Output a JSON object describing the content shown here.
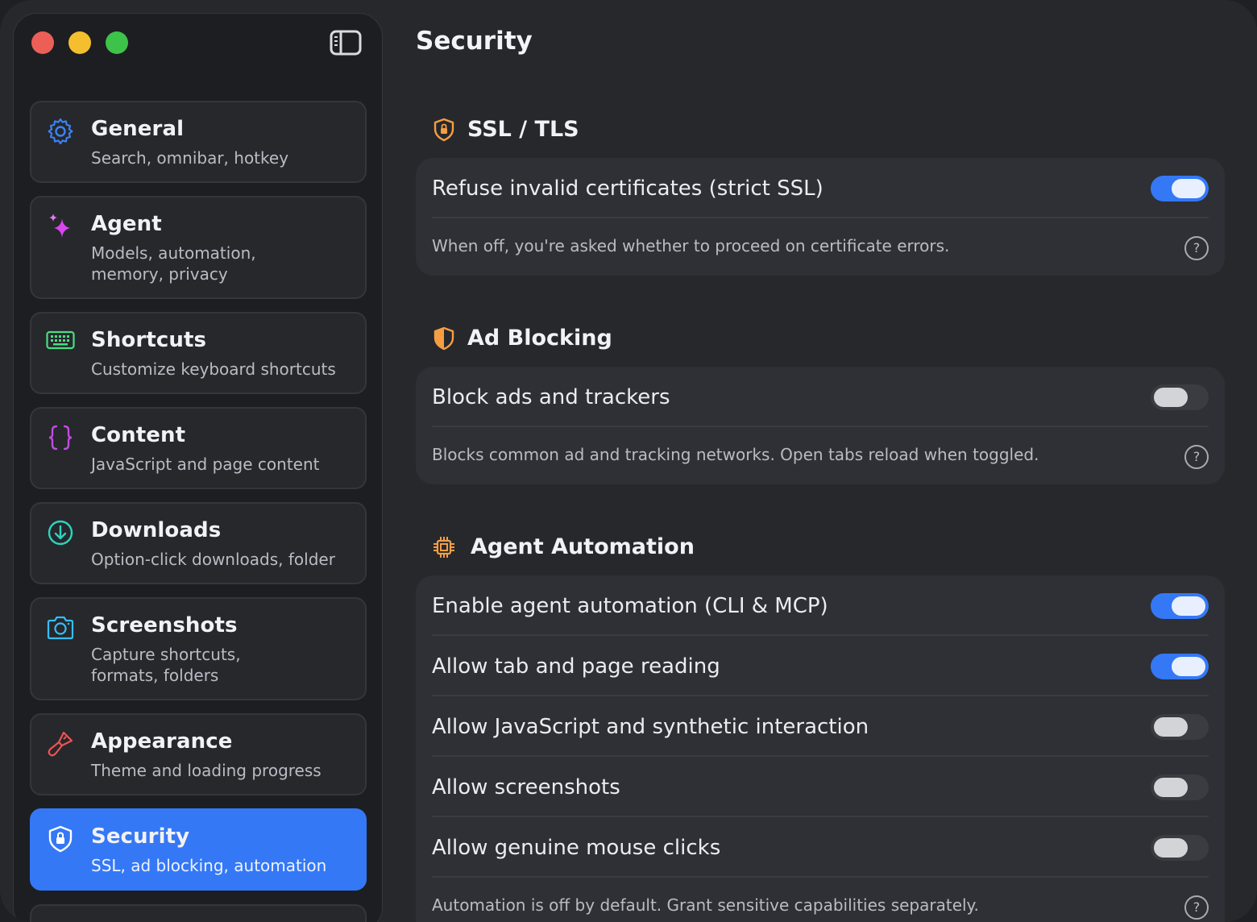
{
  "window": {
    "traffic_lights": [
      "close",
      "minimize",
      "zoom"
    ],
    "sidebar_toggle_icon": "sidebar-left-icon"
  },
  "sidebar": {
    "items": [
      {
        "id": "general",
        "icon": "gear-icon",
        "title": "General",
        "subtitle": "Search, omnibar, hotkey",
        "icon_color": "#3b82f6"
      },
      {
        "id": "agent",
        "icon": "sparkles-icon",
        "title": "Agent",
        "subtitle": "Models, automation, memory, privacy",
        "icon_color": "#d946ef"
      },
      {
        "id": "shortcuts",
        "icon": "keyboard-icon",
        "title": "Shortcuts",
        "subtitle": "Customize keyboard shortcuts",
        "icon_color": "#4ade80"
      },
      {
        "id": "content",
        "icon": "braces-icon",
        "title": "Content",
        "subtitle": "JavaScript and page content",
        "icon_color": "#c04ce0"
      },
      {
        "id": "downloads",
        "icon": "download-circle-icon",
        "title": "Downloads",
        "subtitle": "Option-click downloads, folder",
        "icon_color": "#2dd4bf"
      },
      {
        "id": "screenshots",
        "icon": "camera-icon",
        "title": "Screenshots",
        "subtitle": "Capture shortcuts, formats, folders",
        "icon_color": "#38bdf8"
      },
      {
        "id": "appearance",
        "icon": "paintbrush-icon",
        "title": "Appearance",
        "subtitle": "Theme and loading progress",
        "icon_color": "#f05252"
      },
      {
        "id": "security",
        "icon": "shield-lock-icon",
        "title": "Security",
        "subtitle": "SSL, ad blocking, automation",
        "icon_color": "#ffffff",
        "active": true
      }
    ]
  },
  "main": {
    "title": "Security",
    "sections": [
      {
        "id": "ssl",
        "icon": "shield-lock-icon",
        "icon_color": "#f59e42",
        "title": "SSL / TLS",
        "rows": [
          {
            "label": "Refuse invalid certificates (strict SSL)",
            "enabled": true
          }
        ],
        "hint": "When off, you're asked whether to proceed on certificate errors."
      },
      {
        "id": "adblock",
        "icon": "shield-half-icon",
        "icon_color": "#f59e42",
        "title": "Ad Blocking",
        "rows": [
          {
            "label": "Block ads and trackers",
            "enabled": false
          }
        ],
        "hint": "Blocks common ad and tracking networks. Open tabs reload when toggled."
      },
      {
        "id": "automation",
        "icon": "cpu-chip-icon",
        "icon_color": "#f59e42",
        "title": "Agent Automation",
        "rows": [
          {
            "label": "Enable agent automation (CLI & MCP)",
            "enabled": true
          },
          {
            "label": "Allow tab and page reading",
            "enabled": true
          },
          {
            "label": "Allow JavaScript and synthetic interaction",
            "enabled": false
          },
          {
            "label": "Allow screenshots",
            "enabled": false
          },
          {
            "label": "Allow genuine mouse clicks",
            "enabled": false
          }
        ],
        "hint": "Automation is off by default. Grant sensitive capabilities separately."
      }
    ],
    "help_glyph": "?"
  }
}
